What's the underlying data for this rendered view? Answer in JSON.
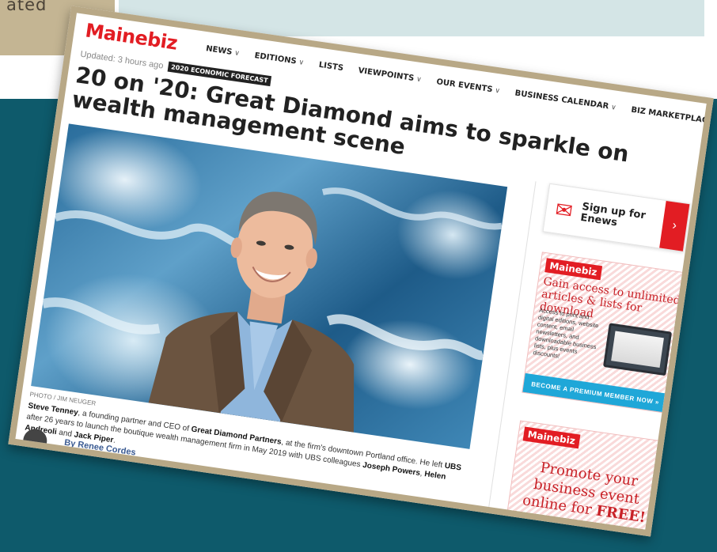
{
  "slide": {
    "corner_text": "ated"
  },
  "site": {
    "logo": "Mainebiz",
    "nav": [
      {
        "label": "NEWS",
        "chevron": true
      },
      {
        "label": "EDITIONS",
        "chevron": true
      },
      {
        "label": "LISTS",
        "chevron": false
      },
      {
        "label": "VIEWPOINTS",
        "chevron": true
      },
      {
        "label": "OUR EVENTS",
        "chevron": true
      },
      {
        "label": "BUSINESS CALENDAR",
        "chevron": true
      },
      {
        "label": "BIZ MARKETPLACE",
        "chevron": true
      }
    ]
  },
  "article": {
    "updated": "Updated: 3 hours ago",
    "tag": "2020 ECONOMIC FORECAST",
    "headline": "20 on '20: Great Diamond aims to sparkle on wealth management scene",
    "photo_credit": "PHOTO / JIM NEUGER",
    "caption": {
      "name": "Steve Tenney",
      "text1": ", a founding partner and CEO of ",
      "firm": "Great Diamond Partners",
      "text2": ", at the firm's downtown Portland office. He left ",
      "ubs": "UBS",
      "text3": " after 26 years to launch the boutique wealth management firm in May 2019 with UBS colleagues ",
      "p1": "Joseph Powers",
      "text4": ", ",
      "p2": "Helen Andreoli",
      "text5": " and ",
      "p3": "Jack Piper",
      "text6": "."
    },
    "byline": "By Renee Cordes"
  },
  "sidebar": {
    "enews": {
      "line1": "Sign up for",
      "line2": "Enews",
      "icon": "envelope-icon"
    },
    "ad1": {
      "logo": "Mainebiz",
      "title": "Gain access to unlimited articles & lists for download",
      "body": "Access to print and digital editions, website content, email newsletters, and downloadable business lists, plus events discounts!",
      "cta": "BECOME A PREMIUM MEMBER NOW »"
    },
    "ad2": {
      "logo": "Mainebiz",
      "title_pre": "Promote your business event online for ",
      "title_bold": "FREE!"
    }
  },
  "colors": {
    "brand_red": "#e21d23",
    "slide_teal": "#0e5a6b",
    "frame_tan": "#b8a886"
  }
}
